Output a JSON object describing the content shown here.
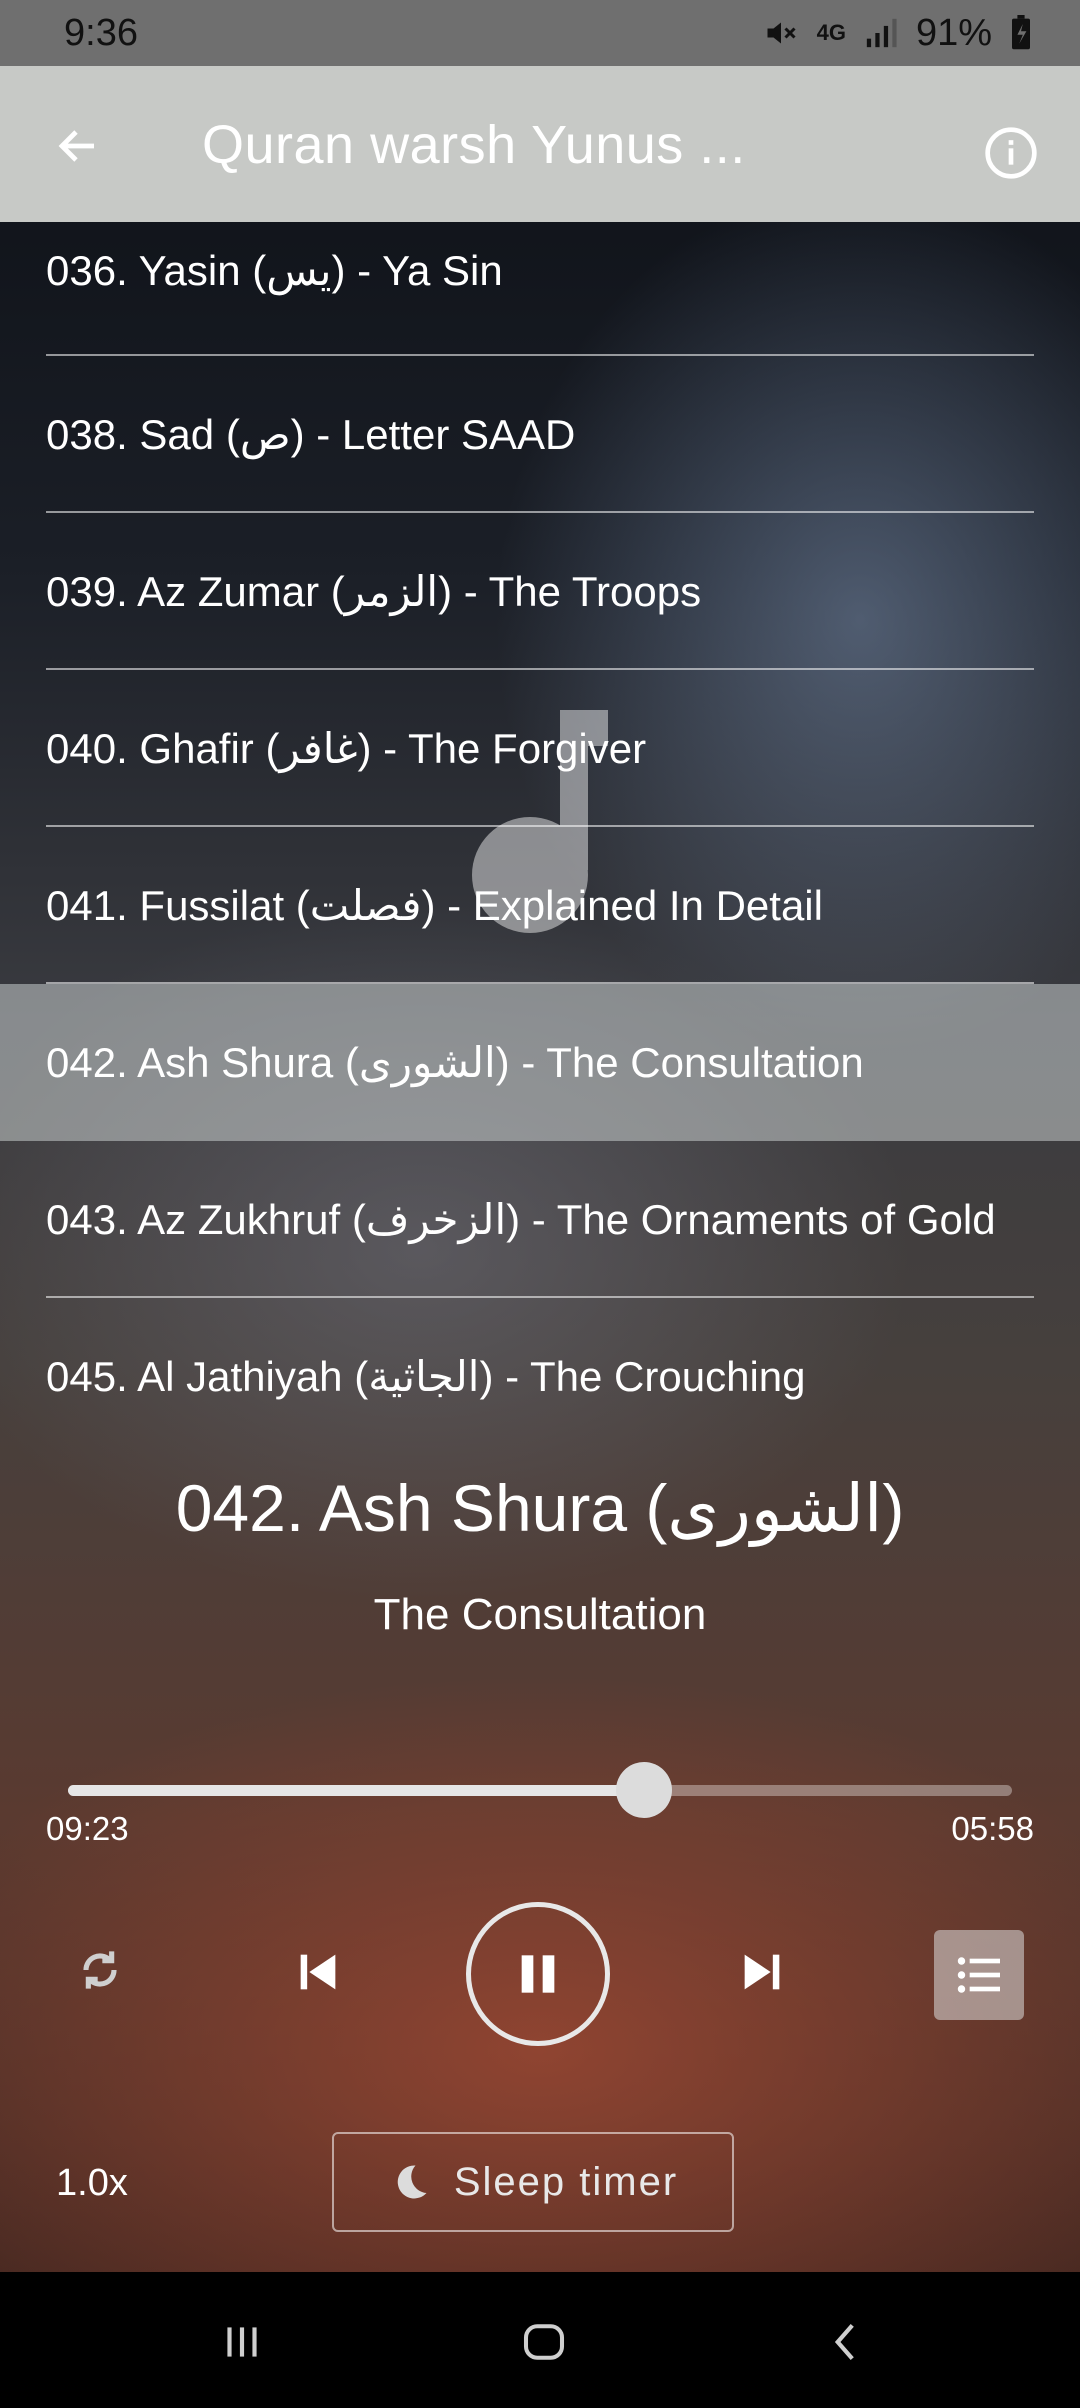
{
  "status_bar": {
    "time": "9:36",
    "network": "4G",
    "battery": "91%"
  },
  "app_bar": {
    "title": "Quran warsh Yunus ..."
  },
  "tracks": [
    {
      "label": "036. Yasin (يس) - Ya Sin"
    },
    {
      "label": "038. Sad (ص) - Letter SAAD"
    },
    {
      "label": "039. Az Zumar (الزمر) - The Troops"
    },
    {
      "label": "040. Ghafir (غافر) - The Forgiver"
    },
    {
      "label": "041. Fussilat (فصلت) - Explained In Detail"
    },
    {
      "label": "042. Ash Shura (الشورى) - The Consultation"
    },
    {
      "label": "043. Az Zukhruf (الزخرف) - The Ornaments of Gold"
    },
    {
      "label": "045. Al Jathiyah (الجاثية) - The Crouching"
    }
  ],
  "player": {
    "title": "042. Ash Shura (الشورى)",
    "subtitle": "The Consultation",
    "elapsed": "09:23",
    "remaining": "05:58",
    "progress_fraction": 0.61,
    "speed": "1.0x",
    "sleep_timer_label": "Sleep timer"
  },
  "colors": {
    "app_bar": "#c7c9c6",
    "status_bar": "#6f6f6f",
    "active_row": "#c8cdcd"
  },
  "icons": {
    "back": "arrow-left-icon",
    "info": "info-icon",
    "repeat": "repeat-icon",
    "prev": "skip-previous-icon",
    "pause": "pause-icon",
    "next": "skip-next-icon",
    "playlist": "playlist-icon",
    "sleep": "moon-icon"
  }
}
